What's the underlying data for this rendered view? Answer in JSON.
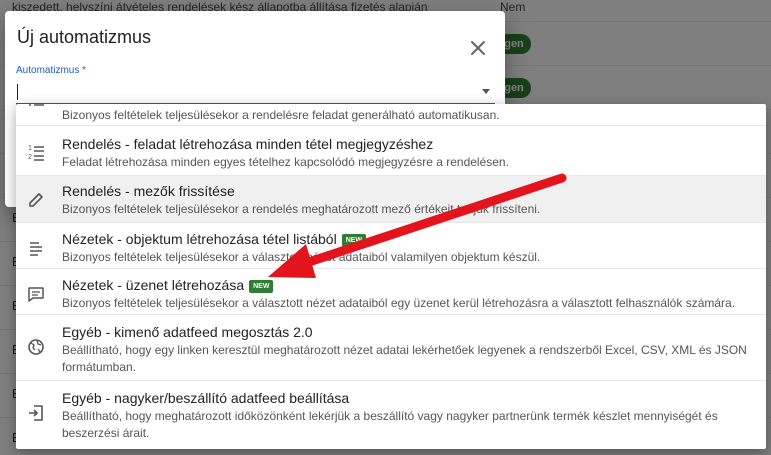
{
  "background": {
    "top_row_text": "kiszedett, helyszíni átvételes rendelések kész állapotba állítása fizetés alapján",
    "top_row_value": "Nem",
    "badge_label": "gen",
    "edge_char": "E"
  },
  "dialog": {
    "title": "Új automatizmus",
    "field_label": "Automatizmus *",
    "field_value": ""
  },
  "menu": {
    "new_badge": "NEW",
    "items": [
      {
        "icon": "list-icon",
        "title": "",
        "desc": "Bizonyos feltételek teljesülésekor a rendelésre feladat generálható automatikusan."
      },
      {
        "icon": "numbered-list-icon",
        "title": "Rendelés - feladat létrehozása minden tétel megjegyzéshez",
        "desc": "Feladat létrehozása minden egyes tételhez kapcsolódó megjegyzésre a rendelésen."
      },
      {
        "icon": "pencil-icon",
        "title": "Rendelés - mezők frissítése",
        "desc": "Bizonyos feltételek teljesülésekor a rendelés meghatározott mező értékeit tudjuk frissíteni."
      },
      {
        "icon": "notes-icon",
        "title": "Nézetek - objektum létrehozása tétel listából",
        "is_new": true,
        "desc": "Bizonyos feltételek teljesülésekor a választott nézet adataiból valamilyen objektum készül."
      },
      {
        "icon": "message-icon",
        "title": "Nézetek - üzenet létrehozása",
        "is_new": true,
        "desc": "Bizonyos feltételek teljesülésekor a választott nézet adataiból egy üzenet kerül létrehozásra a választott felhasználók számára."
      },
      {
        "icon": "globe-icon",
        "title": "Egyéb - kimenő adatfeed megosztás 2.0",
        "desc": "Beállítható, hogy egy linken keresztül meghatározott nézet adatai lekérhetőek legyenek a rendszerből Excel, CSV, XML és JSON formátumban."
      },
      {
        "icon": "import-icon",
        "title": "Egyéb - nagyker/beszállító adatfeed beállítása",
        "desc": "Beállítható, hogy meghatározott időközönként lekérjük a beszállító vagy nagyker partnerünk termék készlet mennyiségét és beszerzési árait."
      }
    ]
  },
  "colors": {
    "accent": "#1e5ac8",
    "badge_green": "#2e7d32",
    "annotation_arrow": "#e3141b"
  }
}
